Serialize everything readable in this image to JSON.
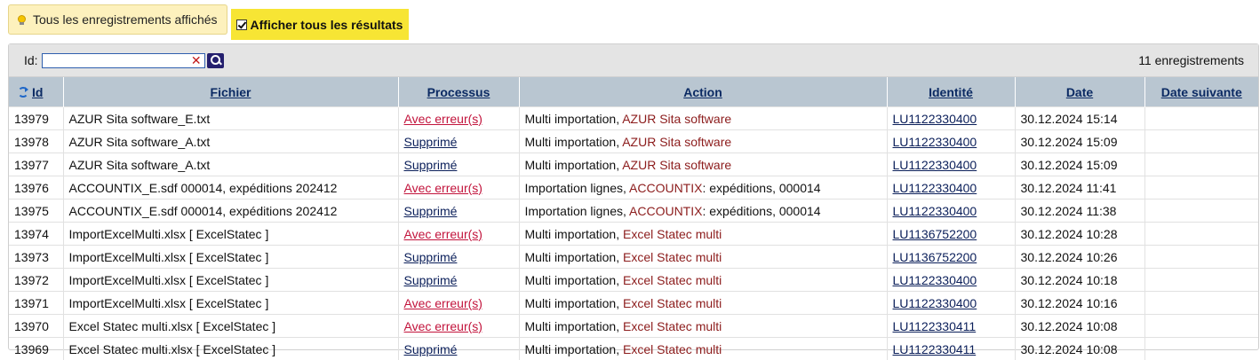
{
  "info": {
    "label": "Tous les enregistrements affichés"
  },
  "toggle": {
    "label": "Afficher tous les résultats",
    "checked": true
  },
  "filter": {
    "label": "Id:",
    "value": "",
    "placeholder": "",
    "count_label": "11 enregistrements"
  },
  "columns": {
    "id": "Id",
    "fichier": "Fichier",
    "processus": "Processus",
    "action": "Action",
    "identite": "Identité",
    "date": "Date",
    "date_suivante": "Date suivante"
  },
  "colors": {
    "error_link": "#c2143c",
    "ok_link": "#0b1f5a",
    "action_source": "#8c1c1c",
    "header_bg": "#b9c6d1",
    "toggle_bg": "#f7e534",
    "info_bg": "#fdf1bd"
  },
  "icons": {
    "info": "lightbulb-icon",
    "toggle": "checkbox-checked-icon",
    "clear": "clear-x-icon",
    "search": "search-icon",
    "refresh": "refresh-icon"
  },
  "rows": [
    {
      "id": "13979",
      "fichier": "AZUR Sita software_E.txt",
      "processus": "Avec erreur(s)",
      "processus_status": "error",
      "action_prefix": "Multi importation, ",
      "action_source": "AZUR Sita software",
      "action_suffix": "",
      "identite": "LU1122330400",
      "date": "30.12.2024 15:14",
      "date_suivante": ""
    },
    {
      "id": "13978",
      "fichier": "AZUR Sita software_A.txt",
      "processus": "Supprimé",
      "processus_status": "ok",
      "action_prefix": "Multi importation, ",
      "action_source": "AZUR Sita software",
      "action_suffix": "",
      "identite": "LU1122330400",
      "date": "30.12.2024 15:09",
      "date_suivante": ""
    },
    {
      "id": "13977",
      "fichier": "AZUR Sita software_A.txt",
      "processus": "Supprimé",
      "processus_status": "ok",
      "action_prefix": "Multi importation, ",
      "action_source": "AZUR Sita software",
      "action_suffix": "",
      "identite": "LU1122330400",
      "date": "30.12.2024 15:09",
      "date_suivante": ""
    },
    {
      "id": "13976",
      "fichier": "ACCOUNTIX_E.sdf 000014, expéditions 202412",
      "processus": "Avec erreur(s)",
      "processus_status": "error",
      "action_prefix": "Importation lignes, ",
      "action_source": "ACCOUNTIX",
      "action_suffix": ": expéditions, 000014",
      "identite": "LU1122330400",
      "date": "30.12.2024 11:41",
      "date_suivante": ""
    },
    {
      "id": "13975",
      "fichier": "ACCOUNTIX_E.sdf 000014, expéditions 202412",
      "processus": "Supprimé",
      "processus_status": "ok",
      "action_prefix": "Importation lignes, ",
      "action_source": "ACCOUNTIX",
      "action_suffix": ": expéditions, 000014",
      "identite": "LU1122330400",
      "date": "30.12.2024 11:38",
      "date_suivante": ""
    },
    {
      "id": "13974",
      "fichier": "ImportExcelMulti.xlsx [ ExcelStatec ]",
      "processus": "Avec erreur(s)",
      "processus_status": "error",
      "action_prefix": "Multi importation, ",
      "action_source": "Excel Statec multi",
      "action_suffix": "",
      "identite": "LU1136752200",
      "date": "30.12.2024 10:28",
      "date_suivante": ""
    },
    {
      "id": "13973",
      "fichier": "ImportExcelMulti.xlsx [ ExcelStatec ]",
      "processus": "Supprimé",
      "processus_status": "ok",
      "action_prefix": "Multi importation, ",
      "action_source": "Excel Statec multi",
      "action_suffix": "",
      "identite": "LU1136752200",
      "date": "30.12.2024 10:26",
      "date_suivante": ""
    },
    {
      "id": "13972",
      "fichier": "ImportExcelMulti.xlsx [ ExcelStatec ]",
      "processus": "Supprimé",
      "processus_status": "ok",
      "action_prefix": "Multi importation, ",
      "action_source": "Excel Statec multi",
      "action_suffix": "",
      "identite": "LU1122330400",
      "date": "30.12.2024 10:18",
      "date_suivante": ""
    },
    {
      "id": "13971",
      "fichier": "ImportExcelMulti.xlsx [ ExcelStatec ]",
      "processus": "Avec erreur(s)",
      "processus_status": "error",
      "action_prefix": "Multi importation, ",
      "action_source": "Excel Statec multi",
      "action_suffix": "",
      "identite": "LU1122330400",
      "date": "30.12.2024 10:16",
      "date_suivante": ""
    },
    {
      "id": "13970",
      "fichier": "Excel Statec multi.xlsx [ ExcelStatec ]",
      "processus": "Avec erreur(s)",
      "processus_status": "error",
      "action_prefix": "Multi importation, ",
      "action_source": "Excel Statec multi",
      "action_suffix": "",
      "identite": "LU1122330411",
      "date": "30.12.2024 10:08",
      "date_suivante": ""
    },
    {
      "id": "13969",
      "fichier": "Excel Statec multi.xlsx [ ExcelStatec ]",
      "processus": "Supprimé",
      "processus_status": "ok",
      "action_prefix": "Multi importation, ",
      "action_source": "Excel Statec multi",
      "action_suffix": "",
      "identite": "LU1122330411",
      "date": "30.12.2024 10:08",
      "date_suivante": ""
    }
  ]
}
